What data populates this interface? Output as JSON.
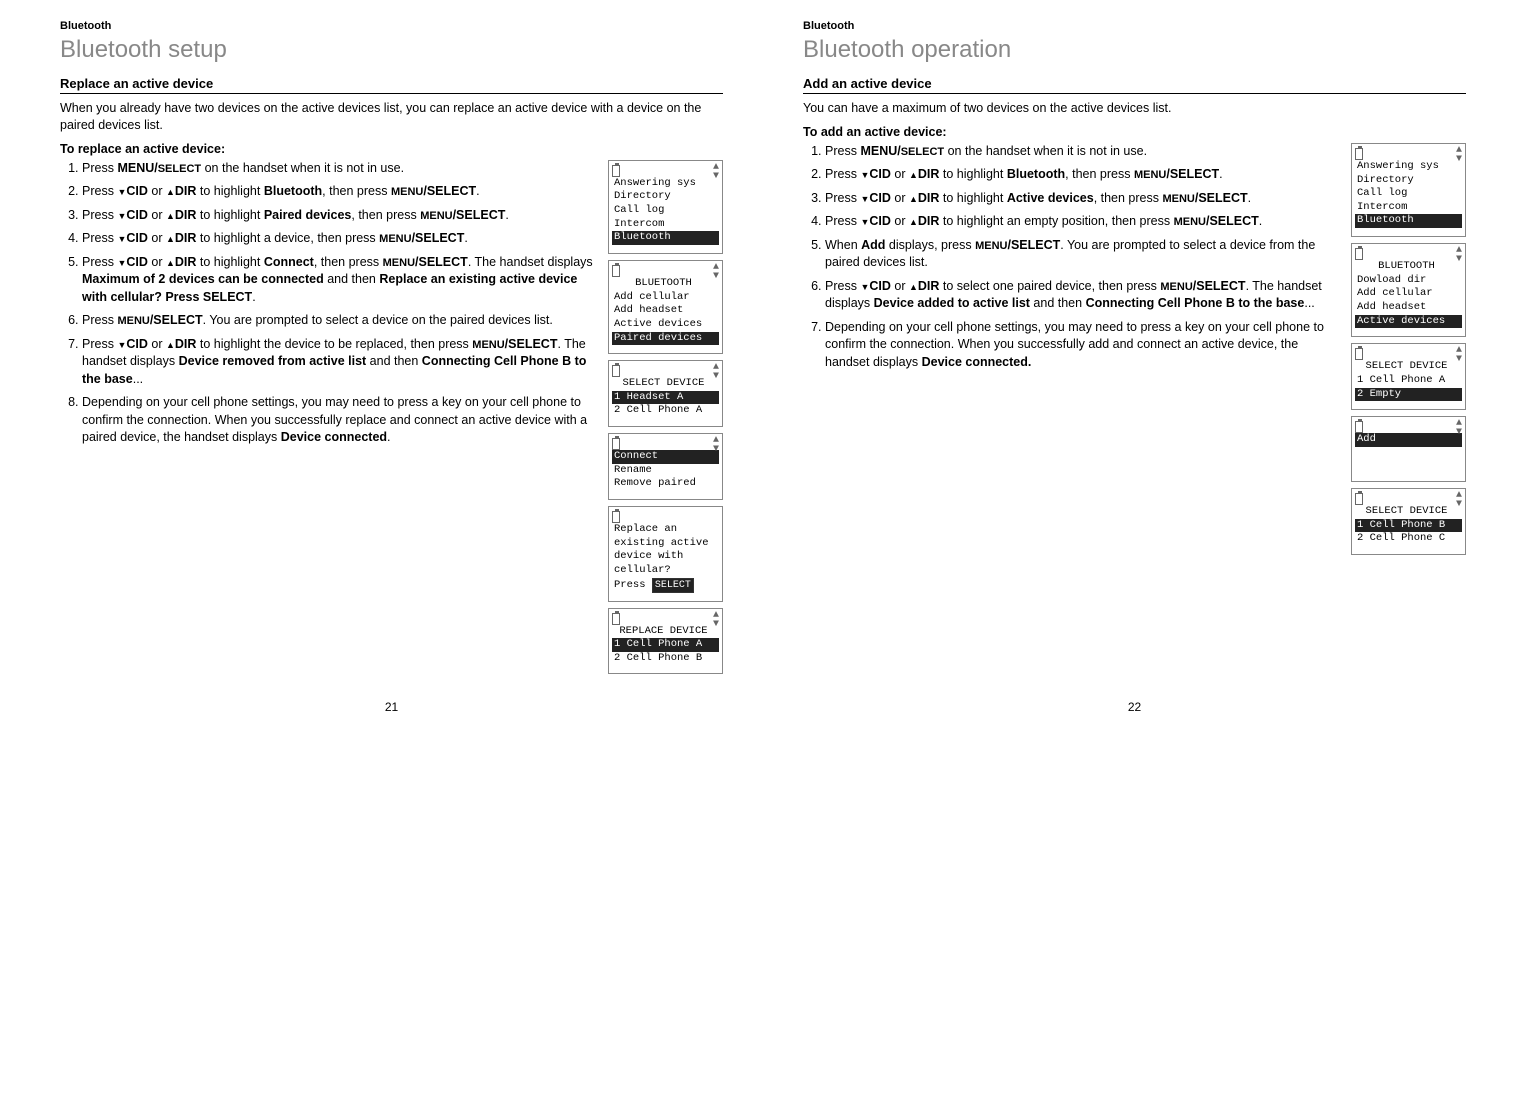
{
  "left": {
    "header": "Bluetooth",
    "title": "Bluetooth setup",
    "subheading": "Replace an active device",
    "intro": "When you already have two devices on the active devices list, you can replace an active device with a device on the paired devices list.",
    "procHeading": "To replace an active device:",
    "steps": {
      "s1a": "Press ",
      "s1b": "MENU/",
      "s1c": "SELECT",
      "s1d": " on the handset when it is not in use.",
      "s2a": "Press ",
      "s2b": "CID",
      "s2c": " or ",
      "s2d": "DIR",
      "s2e": " to highlight ",
      "s2f": "Bluetooth",
      "s2g": ", then press ",
      "s2h": "MENU",
      "s2i": "/SELECT",
      "s2j": ".",
      "s3a": "Press ",
      "s3b": "CID",
      "s3c": " or ",
      "s3d": "DIR",
      "s3e": " to highlight ",
      "s3f": "Paired devices",
      "s3g": ", then press ",
      "s3h": "MENU",
      "s3i": "/SELECT",
      "s3j": ".",
      "s4a": "Press ",
      "s4b": "CID",
      "s4c": " or ",
      "s4d": "DIR",
      "s4e": " to highlight a device, then press ",
      "s4f": "MENU",
      "s4g": "/SELECT",
      "s4h": ".",
      "s5a": "Press ",
      "s5b": "CID",
      "s5c": " or ",
      "s5d": "DIR",
      "s5e": " to highlight ",
      "s5f": "Connect",
      "s5g": ", then press ",
      "s5h": "MENU",
      "s5i": "/SELECT",
      "s5j": ". The handset displays ",
      "s5k": "Maximum of 2 devices can be connected",
      "s5l": " and then ",
      "s5m": "Replace an existing active device with cellular? Press SELECT",
      "s5n": ".",
      "s6a": "Press ",
      "s6b": "MENU",
      "s6c": "/SELECT",
      "s6d": ". You are prompted to select a device on the paired devices list.",
      "s7a": "Press ",
      "s7b": "CID",
      "s7c": " or ",
      "s7d": "DIR",
      "s7e": " to highlight the device to be replaced, then press ",
      "s7f": "MENU",
      "s7g": "/SELECT",
      "s7h": ". The handset displays ",
      "s7i": "Device removed from active list",
      "s7j": " and then ",
      "s7k": "Connecting Cell Phone B to the base",
      "s7l": "...",
      "s8": "Depending on your cell phone settings, you may need to press a key on your cell phone to confirm the connection. When you successfully replace and connect an active device with a paired device, the handset displays ",
      "s8b": "Device connected",
      "s8c": "."
    },
    "screens": {
      "sc1": {
        "l1": "Answering sys",
        "l2": "Directory",
        "l3": "Call log",
        "l4": "Intercom",
        "l5": "Bluetooth"
      },
      "sc2": {
        "ttl": "BLUETOOTH",
        "l1": "Add cellular",
        "l2": "Add headset",
        "l3": "Active devices",
        "l4": "Paired devices"
      },
      "sc3": {
        "ttl": "SELECT DEVICE",
        "l1": "1 Headset A",
        "l2": "2 Cell Phone A"
      },
      "sc4": {
        "l1": "Connect",
        "l2": "Rename",
        "l3": "Remove paired"
      },
      "sc5": {
        "l1": "Replace an",
        "l2": "existing active",
        "l3": "device with",
        "l4": "cellular?",
        "l5a": "Press ",
        "l5b": "SELECT"
      },
      "sc6": {
        "ttl": "REPLACE DEVICE",
        "l1": "1 Cell Phone A",
        "l2": "2 Cell Phone B"
      }
    },
    "pageNum": "21"
  },
  "right": {
    "header": "Bluetooth",
    "title": "Bluetooth operation",
    "subheading": "Add an active device",
    "intro": "You can have a maximum of two devices on the active devices list.",
    "procHeading": "To add an active device:",
    "steps": {
      "s1a": "Press ",
      "s1b": "MENU/",
      "s1c": "SELECT",
      "s1d": " on the handset when it is not in use.",
      "s2a": "Press ",
      "s2b": "CID",
      "s2c": " or ",
      "s2d": "DIR",
      "s2e": " to highlight ",
      "s2f": "Bluetooth",
      "s2g": ", then press ",
      "s2h": "MENU",
      "s2i": "/SELECT",
      "s2j": ".",
      "s3a": "Press ",
      "s3b": "CID",
      "s3c": " or ",
      "s3d": "DIR",
      "s3e": " to highlight ",
      "s3f": "Active devices",
      "s3g": ", then press ",
      "s3h": "MENU",
      "s3i": "/SELECT",
      "s3j": ".",
      "s4a": "Press ",
      "s4b": "CID",
      "s4c": " or ",
      "s4d": "DIR",
      "s4e": " to highlight an empty position, then press ",
      "s4f": "MENU",
      "s4g": "/SELECT",
      "s4h": ".",
      "s5a": "When ",
      "s5b": "Add",
      "s5c": " displays, press ",
      "s5d": "MENU",
      "s5e": "/SELECT",
      "s5f": ". You are prompted to select a device from the paired devices list.",
      "s6a": "Press ",
      "s6b": "CID",
      "s6c": " or ",
      "s6d": "DIR",
      "s6e": " to select one paired device, then press ",
      "s6f": "MENU",
      "s6g": "/SELECT",
      "s6h": ". The handset displays ",
      "s6i": "Device added to active list",
      "s6j": " and then ",
      "s6k": "Connecting Cell Phone B to the base",
      "s6l": "...",
      "s7": "Depending on your cell phone settings, you may need to press a key on your cell phone to confirm the connection. When you successfully add and connect an active device, the handset displays ",
      "s7b": "Device connected.",
      "s7c": ""
    },
    "screens": {
      "sc1": {
        "l1": "Answering sys",
        "l2": "Directory",
        "l3": "Call log",
        "l4": "Intercom",
        "l5": "Bluetooth"
      },
      "sc2": {
        "ttl": "BLUETOOTH",
        "l1": "Dowload dir",
        "l2": "Add cellular",
        "l3": "Add headset",
        "l4": "Active devices"
      },
      "sc3": {
        "ttl": "SELECT DEVICE",
        "l1": "1 Cell Phone A",
        "l2": "2 Empty"
      },
      "sc4": {
        "l1": "Add"
      },
      "sc5": {
        "ttl": "SELECT DEVICE",
        "l1": "1 Cell Phone B",
        "l2": "2 Cell Phone C"
      }
    },
    "pageNum": "22"
  }
}
